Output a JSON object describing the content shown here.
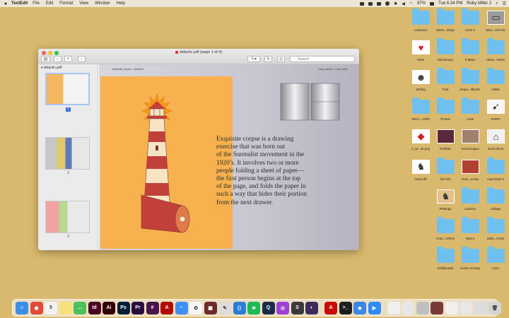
{
  "menubar": {
    "app_name": "TextEdit",
    "items": [
      "File",
      "Edit",
      "Format",
      "View",
      "Window",
      "Help"
    ],
    "battery": "87%",
    "clock": "Tue 6:34 PM",
    "user": "Ruby Miller 2"
  },
  "window": {
    "title": "didactic.pdf (page 1 of 4)",
    "search_placeholder": "Search",
    "sidebar_header": "didactic.pdf",
    "pages": [
      "1",
      "2",
      "3"
    ],
    "page_header_left": "exquisite corpse + drawers",
    "page_header_right": "mary pierce + ruby miller",
    "body_text": "Exquisite corpse is a drawing\nexercise that was born out\nof the Surrealist movement in the\n1920’s. It involves two or more\npeople folding a sheet of paper—\nthe first person begins at the top\nof the page, and folds the paper in\nsuch a way that hides their portion\nfrom the next drawer."
  },
  "desktop": {
    "icons": [
      {
        "label": "Unbound",
        "kind": "folder"
      },
      {
        "label": "MacK...wings",
        "kind": "folder"
      },
      {
        "label": "Color 2",
        "kind": "folder"
      },
      {
        "label": "Maci...ash HD",
        "kind": "drive"
      },
      {
        "label": "Work",
        "kind": "heart"
      },
      {
        "label": "Microscope",
        "kind": "folder"
      },
      {
        "label": "X Mpos",
        "kind": "folder"
      },
      {
        "label": "Helve...Herbs",
        "kind": "folder"
      },
      {
        "label": "Writing",
        "kind": "drawing"
      },
      {
        "label": "Fwd",
        "kind": "folder"
      },
      {
        "label": "Exqui...dbooks",
        "kind": "folder"
      },
      {
        "label": "Artifax",
        "kind": "folder"
      },
      {
        "label": "XRAY...LOPE",
        "kind": "folder"
      },
      {
        "label": "Photos",
        "kind": "folder"
      },
      {
        "label": "Code",
        "kind": "folder"
      },
      {
        "label": "AVERT",
        "kind": "bow"
      },
      {
        "label": "A_tw...sh.png",
        "kind": "diamond"
      },
      {
        "label": "Portfolio",
        "kind": "photo-dark"
      },
      {
        "label": "Good images",
        "kind": "photo-grid"
      },
      {
        "label": "Goal Check",
        "kind": "hanger"
      },
      {
        "label": "Horse.tiff",
        "kind": "horses"
      },
      {
        "label": "font info",
        "kind": "folder"
      },
      {
        "label": "Gran...enses",
        "kind": "photo-red"
      },
      {
        "label": "coat check 2",
        "kind": "folder"
      },
      {
        "label": "Printings",
        "kind": "animal"
      },
      {
        "label": "Lasvilon",
        "kind": "folder"
      },
      {
        "label": "Collage",
        "kind": "folder"
      },
      {
        "label": "Scan...cshme",
        "kind": "folder"
      },
      {
        "label": "Macro",
        "kind": "folder"
      },
      {
        "label": "Datle...Fonts",
        "kind": "folder"
      },
      {
        "label": "SolidQuests",
        "kind": "folder"
      },
      {
        "label": "evolve moving",
        "kind": "folder"
      },
      {
        "label": "Color",
        "kind": "folder"
      }
    ]
  },
  "dock": {
    "apps": [
      {
        "name": "finder-icon",
        "color": "#3c8ee6",
        "glyph": "☺"
      },
      {
        "name": "chrome-icon",
        "color": "#e04a3b",
        "glyph": "◉"
      },
      {
        "name": "calendar-icon",
        "color": "#f2f2f2",
        "glyph": "5"
      },
      {
        "name": "notes-icon",
        "color": "#f7e27a",
        "glyph": ""
      },
      {
        "name": "messages-icon",
        "color": "#4ec25a",
        "glyph": "…"
      },
      {
        "name": "indesign-icon",
        "color": "#49021f",
        "glyph": "Id"
      },
      {
        "name": "illustrator-icon",
        "color": "#330000",
        "glyph": "Ai"
      },
      {
        "name": "photoshop-icon",
        "color": "#001e36",
        "glyph": "Ps"
      },
      {
        "name": "premiere-icon",
        "color": "#2a0a3a",
        "glyph": "Pr"
      },
      {
        "name": "slack-icon",
        "color": "#4a154b",
        "glyph": "#"
      },
      {
        "name": "acrobat-icon",
        "color": "#b30b00",
        "glyph": "A"
      },
      {
        "name": "messenger-icon",
        "color": "#3b8ff5",
        "glyph": "~"
      },
      {
        "name": "photos-icon",
        "color": "#f6f6f6",
        "glyph": "✿"
      },
      {
        "name": "pixelmator-icon",
        "color": "#6c2a2a",
        "glyph": "▦"
      },
      {
        "name": "script-editor-icon",
        "color": "#dcdcdc",
        "glyph": "✎"
      },
      {
        "name": "vscode-icon",
        "color": "#2a7ed8",
        "glyph": "⟨⟩"
      },
      {
        "name": "spotify-icon",
        "color": "#1db954",
        "glyph": "≋"
      },
      {
        "name": "quicktime-icon",
        "color": "#1a2a4a",
        "glyph": "Q"
      },
      {
        "name": "podcasts-icon",
        "color": "#9b3fd6",
        "glyph": "◎"
      },
      {
        "name": "sublime-icon",
        "color": "#3a3a3a",
        "glyph": "S"
      },
      {
        "name": "tor-icon",
        "color": "#3c2c5c",
        "glyph": "◐"
      },
      {
        "name": "sep1",
        "color": "",
        "glyph": ""
      },
      {
        "name": "acrobat-reader-icon",
        "color": "#c70a0a",
        "glyph": "A"
      },
      {
        "name": "terminal-icon",
        "color": "#1e1e1e",
        "glyph": ">_"
      },
      {
        "name": "dropbox-icon",
        "color": "#3a88e6",
        "glyph": "◆"
      },
      {
        "name": "zoom-icon",
        "color": "#2d8cff",
        "glyph": "▶"
      },
      {
        "name": "sep2",
        "color": "",
        "glyph": ""
      },
      {
        "name": "recent-doc-1-icon",
        "color": "#f0f0f0",
        "glyph": ""
      },
      {
        "name": "recent-doc-2-icon",
        "color": "#e6e6e6",
        "glyph": ""
      },
      {
        "name": "recent-doc-3-icon",
        "color": "#bfbfbf",
        "glyph": ""
      },
      {
        "name": "recent-doc-4-icon",
        "color": "#7a3a3a",
        "glyph": ""
      },
      {
        "name": "recent-doc-5-icon",
        "color": "#f0f0f0",
        "glyph": ""
      },
      {
        "name": "recent-doc-6-icon",
        "color": "#e8e8e8",
        "glyph": ""
      },
      {
        "name": "recent-doc-7-icon",
        "color": "#dcdcdc",
        "glyph": ""
      },
      {
        "name": "trash-icon",
        "color": "#d4d4d4",
        "glyph": "🗑"
      }
    ]
  }
}
